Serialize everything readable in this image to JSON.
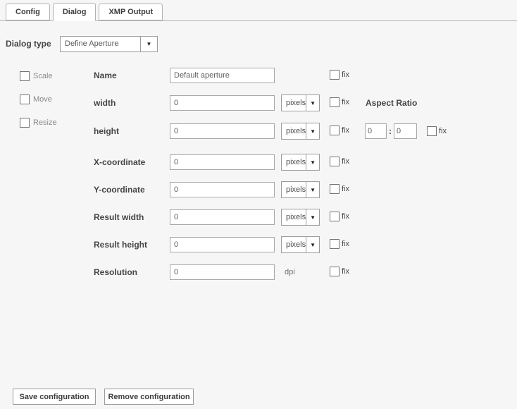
{
  "tabs": [
    {
      "label": "Config",
      "active": false
    },
    {
      "label": "Dialog",
      "active": true
    },
    {
      "label": "XMP Output",
      "active": false
    }
  ],
  "dialog_type": {
    "label": "Dialog type",
    "value": "Define Aperture"
  },
  "modes": [
    {
      "label": "Scale",
      "checked": false
    },
    {
      "label": "Move",
      "checked": false
    },
    {
      "label": "Resize",
      "checked": false
    }
  ],
  "fields": [
    {
      "label": "Name",
      "value": "Default aperture",
      "unit": null,
      "fix": "fix",
      "fix_checked": false
    },
    {
      "label": "width",
      "value": "0",
      "unit": "pixels",
      "fix": "fix",
      "fix_checked": false
    },
    {
      "label": "height",
      "value": "0",
      "unit": "pixels",
      "fix": "fix",
      "fix_checked": false
    },
    {
      "label": "X-coordinate",
      "value": "0",
      "unit": "pixels",
      "fix": "fix",
      "fix_checked": false
    },
    {
      "label": "Y-coordinate",
      "value": "0",
      "unit": "pixels",
      "fix": "fix",
      "fix_checked": false
    },
    {
      "label": "Result width",
      "value": "0",
      "unit": "pixels",
      "fix": "fix",
      "fix_checked": false
    },
    {
      "label": "Result height",
      "value": "0",
      "unit": "pixels",
      "fix": "fix",
      "fix_checked": false
    },
    {
      "label": "Resolution",
      "value": "0",
      "unit": "dpi",
      "fix": "fix",
      "fix_checked": false
    }
  ],
  "aspect_ratio": {
    "label": "Aspect Ratio",
    "left_value": "0",
    "separator": ":",
    "right_value": "0",
    "fix": "fix",
    "fix_checked": false
  },
  "buttons": {
    "save": "Save configuration",
    "remove": "Remove configuration"
  },
  "icons": {
    "dropdown_arrow": "▼"
  },
  "colors": {
    "background": "#f6f6f6",
    "surface": "#ffffff",
    "border": "#9c9c9c",
    "label_text": "#454545",
    "muted_text": "#8a8a8a"
  }
}
